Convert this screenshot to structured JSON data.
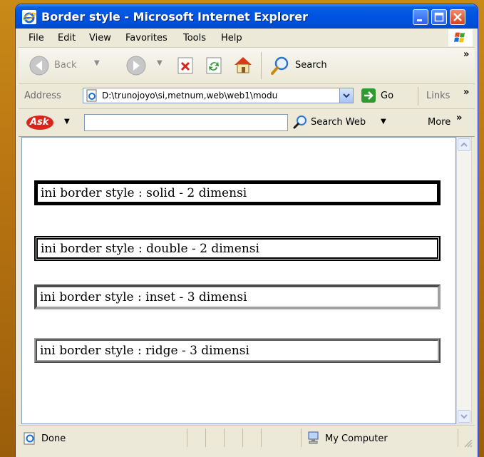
{
  "window": {
    "title": "Border style - Microsoft Internet Explorer"
  },
  "menu": {
    "items": [
      "File",
      "Edit",
      "View",
      "Favorites",
      "Tools",
      "Help"
    ]
  },
  "toolbar": {
    "back_label": "Back",
    "search_label": "Search",
    "chevron": "»"
  },
  "address": {
    "label": "Address",
    "value": "D:\\trunojoyo\\si,metnum,web\\web1\\modu",
    "go_label": "Go",
    "links_label": "Links",
    "chevron": "»"
  },
  "askbar": {
    "logo_text": "Ask",
    "search_value": "",
    "search_web_label": "Search Web",
    "more_label": "More",
    "more_chevron": "»"
  },
  "content": {
    "boxes": [
      "ini border style : solid - 2 dimensi",
      "ini border style : double - 2 dimensi",
      "ini border style : inset - 3 dimensi",
      "ini border style : ridge - 3 dimensi"
    ]
  },
  "status": {
    "text": "Done",
    "zone": "My Computer"
  },
  "colors": {
    "titlebar": "#0054e3",
    "chrome": "#ece9d8",
    "desktop": "#b87412"
  }
}
